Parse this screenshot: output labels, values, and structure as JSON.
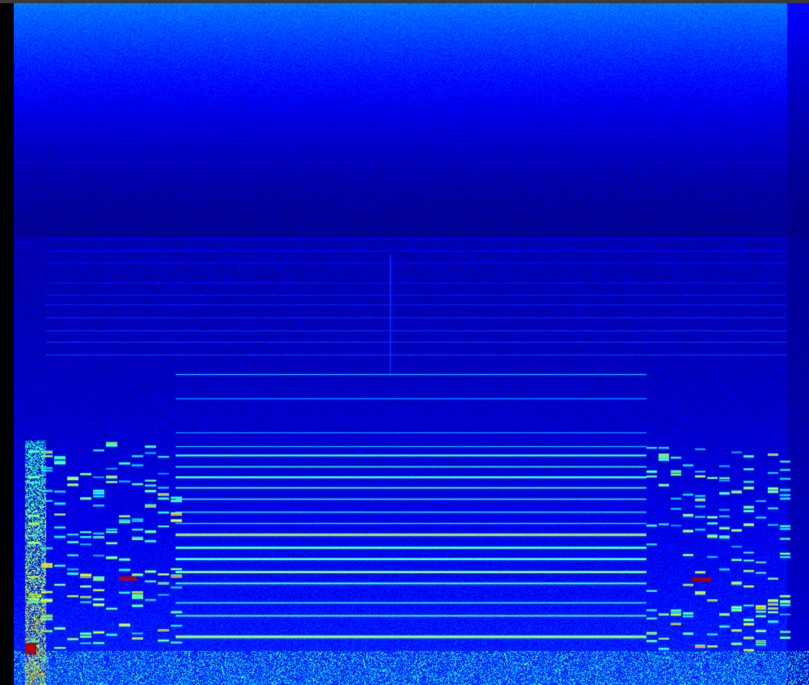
{
  "image": {
    "kind": "spectrogram",
    "colormap": "jet",
    "colors": {
      "background_top": "#0a1a6a",
      "background_dark": "#000000",
      "low": "#0a2a9a",
      "mid": "#00c8ff",
      "high": "#ffff00",
      "peak": "#ff2020"
    }
  }
}
